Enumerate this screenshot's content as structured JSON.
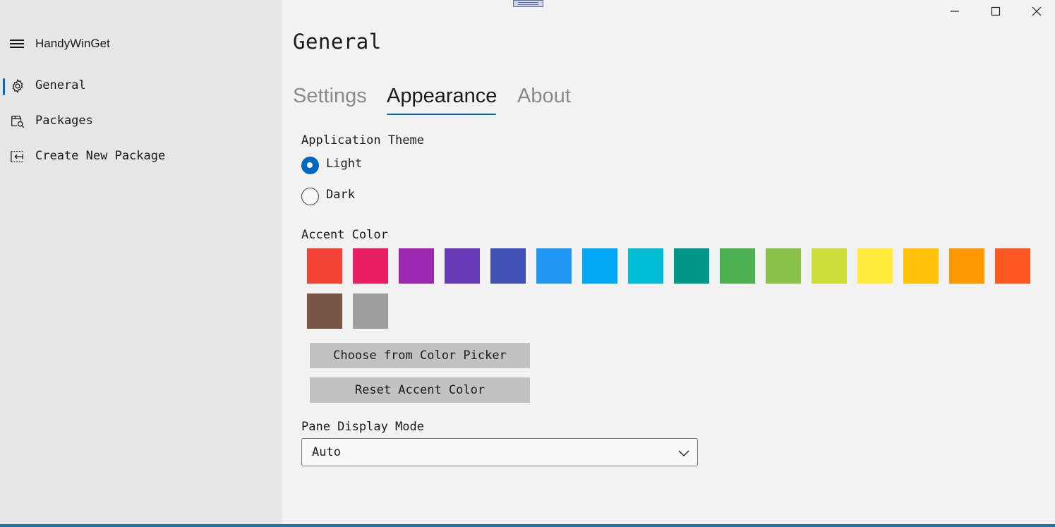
{
  "app": {
    "title": "HandyWinGet"
  },
  "sidebar": {
    "items": [
      {
        "label": "General",
        "icon": "gear-icon",
        "selected": true
      },
      {
        "label": "Packages",
        "icon": "package-search-icon",
        "selected": false
      },
      {
        "label": "Create New Package",
        "icon": "create-package-icon",
        "selected": false
      }
    ]
  },
  "window_controls": [
    "minimize-icon",
    "maximize-icon",
    "close-icon"
  ],
  "page": {
    "title": "General",
    "tabs": [
      {
        "label": "Settings",
        "active": false
      },
      {
        "label": "Appearance",
        "active": true
      },
      {
        "label": "About",
        "active": false
      }
    ]
  },
  "appearance": {
    "theme_label": "Application Theme",
    "theme_options": [
      {
        "label": "Light",
        "checked": true
      },
      {
        "label": "Dark",
        "checked": false
      }
    ],
    "accent_label": "Accent Color",
    "accent_colors": [
      "#f44336",
      "#e91e63",
      "#9c27b0",
      "#673ab7",
      "#3f51b5",
      "#2196f3",
      "#03a9f4",
      "#00bcd4",
      "#009688",
      "#4caf50",
      "#8bc34a",
      "#cddc39",
      "#ffeb3b",
      "#ffc107",
      "#ff9800",
      "#ff5722",
      "#795548",
      "#9e9e9e"
    ],
    "color_picker_button": "Choose from Color Picker",
    "reset_accent_button": "Reset Accent Color",
    "pane_mode_label": "Pane Display Mode",
    "pane_mode_value": "Auto"
  },
  "colors": {
    "accent": "#0067c0",
    "sidebar_bg": "#e6e6e6",
    "content_bg": "#f2f2f2",
    "button_bg": "#c2c2c2"
  }
}
